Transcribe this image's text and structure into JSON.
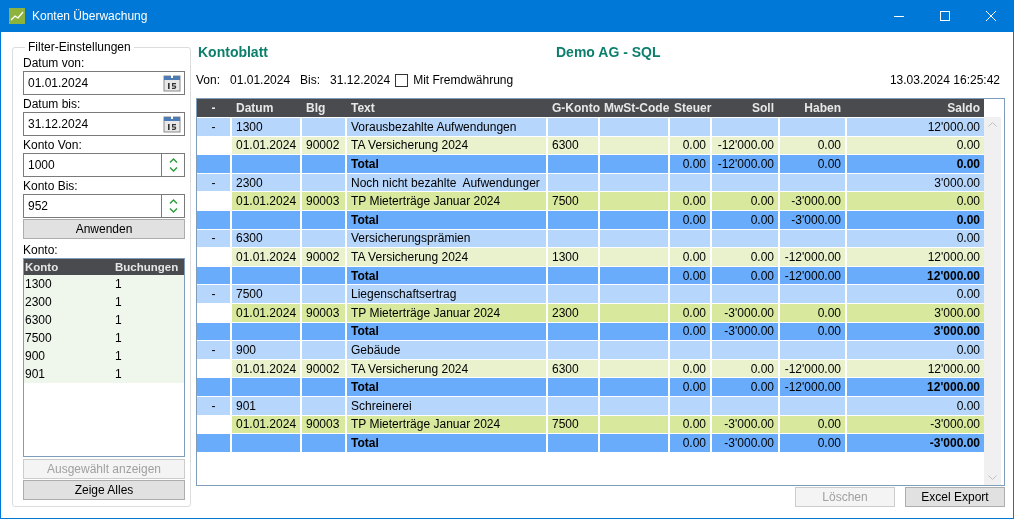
{
  "window": {
    "title": "Konten Überwachung"
  },
  "filter": {
    "title": "Filter-Einstellungen",
    "fields": [
      {
        "kind": "date",
        "label": "Datum von:",
        "value": "01.01.2024"
      },
      {
        "kind": "date",
        "label": "Datum bis:",
        "value": "31.12.2024"
      },
      {
        "kind": "spin",
        "label": "Konto Von:",
        "value": "1000"
      },
      {
        "kind": "spin",
        "label": "Konto Bis:",
        "value": "952"
      }
    ],
    "apply_button": "Anwenden",
    "list_label": "Konto:",
    "list": {
      "columns": [
        "Konto",
        "Buchungen"
      ],
      "rows": [
        [
          "1300",
          "1"
        ],
        [
          "2300",
          "1"
        ],
        [
          "6300",
          "1"
        ],
        [
          "7500",
          "1"
        ],
        [
          "900",
          "1"
        ],
        [
          "901",
          "1"
        ]
      ]
    },
    "buttons": [
      {
        "label": "Ausgewählt anzeigen",
        "disabled": true
      },
      {
        "label": "Zeige Alles",
        "disabled": false
      }
    ]
  },
  "report": {
    "title": "Kontoblatt",
    "company": "Demo AG - SQL",
    "from_label": "Von:",
    "from": "01.01.2024",
    "to_label": "Bis:",
    "to": "31.12.2024",
    "foreign_currency": {
      "label": "Mit Fremdwährung",
      "checked": false
    },
    "timestamp": "13.03.2024 16:25:42"
  },
  "table": {
    "columns": [
      "-",
      "Datum",
      "Blg",
      "Text",
      "G-Konto",
      "MwSt-Code",
      "Steuer",
      "Soll",
      "Haben",
      "Saldo"
    ],
    "rows": [
      {
        "kind": "group",
        "toggle": "-",
        "account": "1300",
        "text": "Vorausbezahlte Aufwendungen",
        "saldo": "12'000.00"
      },
      {
        "kind": "detail",
        "color": "#eaf2cd",
        "datum": "01.01.2024",
        "blg": "90002",
        "text": "TA Versicherung 2024",
        "g_konto": "6300",
        "steuer": "0.00",
        "soll": "-12'000.00",
        "haben": "0.00",
        "saldo": "0.00"
      },
      {
        "kind": "total",
        "text": "Total",
        "steuer": "0.00",
        "soll": "-12'000.00",
        "haben": "0.00",
        "saldo": "0.00"
      },
      {
        "kind": "group",
        "toggle": "-",
        "account": "2300",
        "text": "Noch nicht bezahlte  Aufwendunger",
        "saldo": "3'000.00"
      },
      {
        "kind": "detail",
        "color": "#d8e89c",
        "datum": "01.01.2024",
        "blg": "90003",
        "text": "TP Mieterträge Januar 2024",
        "g_konto": "7500",
        "steuer": "0.00",
        "soll": "0.00",
        "haben": "-3'000.00",
        "saldo": "0.00"
      },
      {
        "kind": "total",
        "text": "Total",
        "steuer": "0.00",
        "soll": "0.00",
        "haben": "-3'000.00",
        "saldo": "0.00"
      },
      {
        "kind": "group",
        "toggle": "-",
        "account": "6300",
        "text": "Versicherungsprämien",
        "saldo": "0.00"
      },
      {
        "kind": "detail",
        "color": "#eaf2cd",
        "datum": "01.01.2024",
        "blg": "90002",
        "text": "TA Versicherung 2024",
        "g_konto": "1300",
        "steuer": "0.00",
        "soll": "0.00",
        "haben": "-12'000.00",
        "saldo": "12'000.00"
      },
      {
        "kind": "total",
        "text": "Total",
        "steuer": "0.00",
        "soll": "0.00",
        "haben": "-12'000.00",
        "saldo": "12'000.00"
      },
      {
        "kind": "group",
        "toggle": "-",
        "account": "7500",
        "text": "Liegenschaftsertrag",
        "saldo": "0.00"
      },
      {
        "kind": "detail",
        "color": "#d8e89c",
        "datum": "01.01.2024",
        "blg": "90003",
        "text": "TP Mieterträge Januar 2024",
        "g_konto": "2300",
        "steuer": "0.00",
        "soll": "-3'000.00",
        "haben": "0.00",
        "saldo": "3'000.00"
      },
      {
        "kind": "total",
        "text": "Total",
        "steuer": "0.00",
        "soll": "-3'000.00",
        "haben": "0.00",
        "saldo": "3'000.00"
      },
      {
        "kind": "group",
        "toggle": "-",
        "account": "900",
        "text": "Gebäude",
        "saldo": "0.00"
      },
      {
        "kind": "detail",
        "color": "#eaf2cd",
        "datum": "01.01.2024",
        "blg": "90002",
        "text": "TA Versicherung 2024",
        "g_konto": "6300",
        "steuer": "0.00",
        "soll": "0.00",
        "haben": "-12'000.00",
        "saldo": "12'000.00"
      },
      {
        "kind": "total",
        "text": "Total",
        "steuer": "0.00",
        "soll": "0.00",
        "haben": "-12'000.00",
        "saldo": "12'000.00"
      },
      {
        "kind": "group",
        "toggle": "-",
        "account": "901",
        "text": "Schreinerei",
        "saldo": "0.00"
      },
      {
        "kind": "detail",
        "color": "#d8e89c",
        "datum": "01.01.2024",
        "blg": "90003",
        "text": "TP Mieterträge Januar 2024",
        "g_konto": "7500",
        "steuer": "0.00",
        "soll": "-3'000.00",
        "haben": "0.00",
        "saldo": "-3'000.00"
      },
      {
        "kind": "total",
        "text": "Total",
        "steuer": "0.00",
        "soll": "-3'000.00",
        "haben": "0.00",
        "saldo": "-3'000.00"
      }
    ]
  },
  "buttons": [
    {
      "label": "Löschen",
      "disabled": true
    },
    {
      "label": "Excel Export",
      "disabled": false
    }
  ]
}
